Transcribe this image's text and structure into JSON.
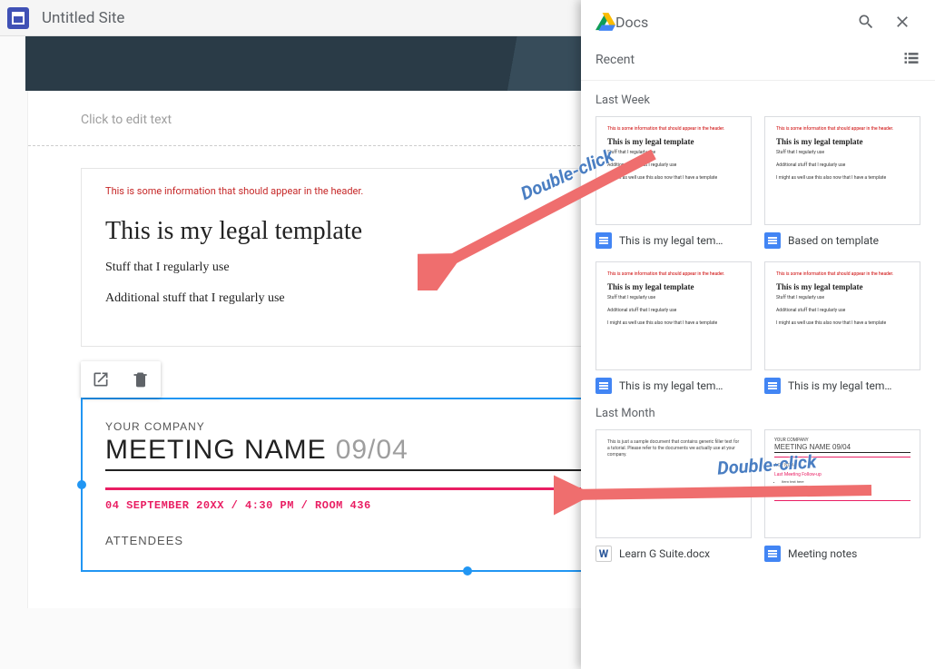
{
  "appbar": {
    "site_title": "Untitled Site"
  },
  "canvas": {
    "placeholder": "Click to edit text",
    "doc1": {
      "header_note": "This is some information that should appear in the header.",
      "title": "This is my legal template",
      "line1": "Stuff that I regularly use",
      "line2": "Additional stuff that I regularly use"
    },
    "doc2": {
      "company": "YOUR COMPANY",
      "meeting": "MEETING NAME",
      "meeting_date": "09/04",
      "detail": "04 SEPTEMBER 20XX / 4:30 PM / ROOM 436",
      "attendees_label": "ATTENDEES"
    }
  },
  "panel": {
    "title": "Docs",
    "recent_label": "Recent",
    "sections": {
      "last_week": "Last Week",
      "last_month": "Last Month"
    },
    "thumb_legal": {
      "red": "This is some information that should appear in the header.",
      "title": "This is my legal template",
      "l1": "Stuff that I regularly use",
      "l2": "Additional stuff that I regularly use",
      "l3": "I might as well use this also now that I have a template"
    },
    "thumb_meeting": {
      "company": "YOUR COMPANY",
      "title": "MEETING NAME 09/04",
      "agenda": "AGENDA",
      "pink": "Last Meeting Follow-up"
    },
    "cards": [
      "This is my legal tem…",
      "Based on template",
      "This is my legal tem…",
      "This is my legal tem…",
      "Learn G Suite.docx",
      "Meeting notes"
    ],
    "word_letter": "W"
  },
  "annotations": {
    "label": "Double-click"
  }
}
